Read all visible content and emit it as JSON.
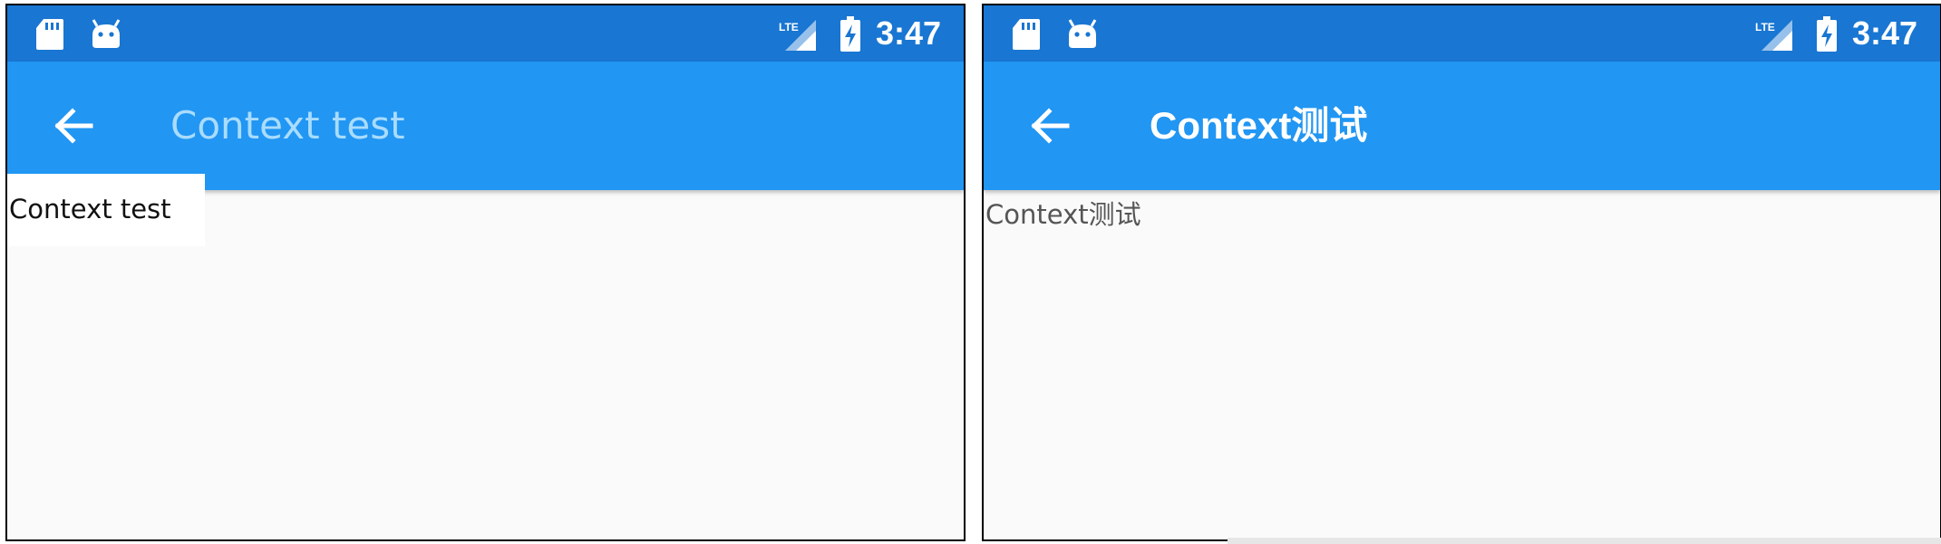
{
  "screens": [
    {
      "status_bar": {
        "time": "3:47",
        "icons": [
          "sd-card-icon",
          "android-icon",
          "lte-signal-icon",
          "battery-charging-icon"
        ]
      },
      "app_bar": {
        "back_icon": "arrow-back-icon",
        "title": "Context test"
      },
      "body": {
        "text": "Context test"
      }
    },
    {
      "status_bar": {
        "time": "3:47",
        "icons": [
          "sd-card-icon",
          "android-icon",
          "lte-signal-icon",
          "battery-charging-icon"
        ]
      },
      "app_bar": {
        "back_icon": "arrow-back-icon",
        "title": "Context测试"
      },
      "body": {
        "text": "Context测试"
      }
    }
  ],
  "colors": {
    "status_bar": "#1976d2",
    "app_bar": "#2196f3",
    "background": "#fafafa",
    "left_title": "#a9dcff",
    "right_title": "#ffffff"
  }
}
